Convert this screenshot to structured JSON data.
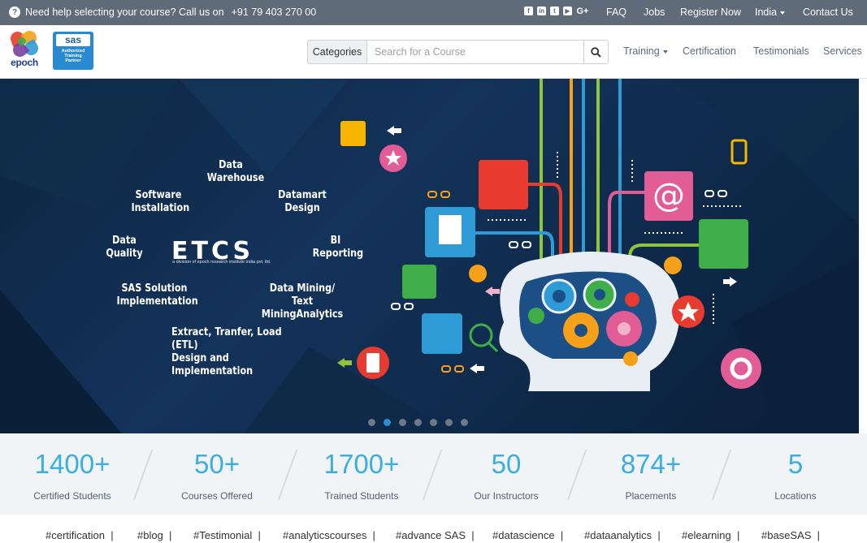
{
  "topbar": {
    "help_text": "Need help selecting your course? Call us on",
    "phone": "+91 79 403 270 00",
    "social_icons": [
      "facebook-icon",
      "linkedin-icon",
      "twitter-icon",
      "youtube-icon",
      "google-plus-icon"
    ],
    "gplus_glyph": "G+",
    "links": [
      "FAQ",
      "Jobs",
      "Register Now",
      "India",
      "Contact Us"
    ]
  },
  "header": {
    "logo_text": "epoch",
    "sas_logo": {
      "brand": "sas",
      "line1": "Authorized",
      "line2": "Training",
      "line3": "Partner"
    },
    "categories_label": "Categories",
    "search_placeholder": "Search for a Course",
    "nav": [
      "Training",
      "Certification",
      "Testimonials",
      "Services"
    ]
  },
  "hero": {
    "etcs": "ETCS",
    "etcs_sub": "a division of epoch research institute india pvt. ltd.",
    "topics": {
      "data_warehouse": "Data\nWarehouse",
      "software_installation": "Software\nInstallation",
      "datamart_design": "Datamart\nDesign",
      "data_quality": "Data\nQuality",
      "bi_reporting": "BI\nReporting",
      "sas_solution": "SAS Solution\nImplementation",
      "data_mining": "Data Mining/\nText MiningAnalytics",
      "etl": "Extract, Tranfer, Load (ETL)\nDesign and Implementation"
    },
    "slide_count": 7,
    "active_slide": 2
  },
  "stats": [
    {
      "value": "1400+",
      "label": "Certified Students"
    },
    {
      "value": "50+",
      "label": "Courses Offered"
    },
    {
      "value": "1700+",
      "label": "Trained Students"
    },
    {
      "value": "50",
      "label": "Our Instructors"
    },
    {
      "value": "874+",
      "label": "Placements"
    },
    {
      "value": "5",
      "label": "Locations"
    }
  ],
  "tags": [
    "#certification",
    "#blog",
    "#Testimonial",
    "#analyticscourses",
    "#advance SAS",
    "#datascience",
    "#dataanalytics",
    "#elearning",
    "#baseSAS"
  ],
  "colors": {
    "topbar": "#606b79",
    "accent": "#3aaee0",
    "hero_bg": "#0c2440"
  }
}
